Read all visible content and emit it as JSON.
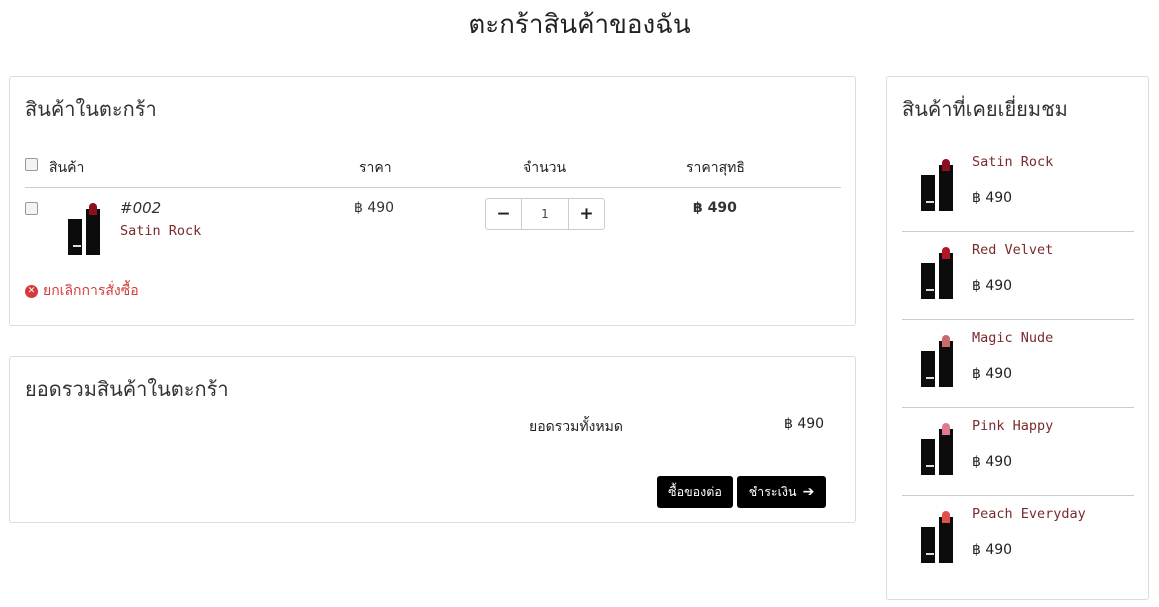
{
  "page": {
    "title": "ตะกร้าสินค้าของฉัน"
  },
  "cart": {
    "heading": "สินค้าในตะกร้า",
    "columns": {
      "product": "สินค้า",
      "price": "ราคา",
      "quantity": "จำนวน",
      "net_price": "ราคาสุทธิ"
    },
    "items": [
      {
        "code": "#002",
        "name": "Satin Rock",
        "price": "฿ 490",
        "quantity": "1",
        "net_price": "฿ 490",
        "shade": "#8a1020"
      }
    ],
    "decrement_label": "−",
    "increment_label": "+",
    "cancel_label": "ยกเลิกการสั่งซื้อ"
  },
  "summary": {
    "heading": "ยอดรวมสินค้าในตะกร้า",
    "total_label": "ยอดรวมทั้งหมด",
    "total_value": "฿ 490",
    "continue_label": "ซื้อของต่อ",
    "checkout_label": "ชำระเงิน"
  },
  "viewed": {
    "heading": "สินค้าที่เคยเยี่ยมชม",
    "items": [
      {
        "name": "Satin Rock",
        "price": "฿ 490",
        "shade": "#8a1020"
      },
      {
        "name": "Red Velvet",
        "price": "฿ 490",
        "shade": "#b0182a"
      },
      {
        "name": "Magic Nude",
        "price": "฿ 490",
        "shade": "#c96a6c"
      },
      {
        "name": "Pink Happy",
        "price": "฿ 490",
        "shade": "#e07a90"
      },
      {
        "name": "Peach Everyday",
        "price": "฿ 490",
        "shade": "#e0504a"
      }
    ]
  },
  "colors": {
    "link": "#7a2a2a",
    "danger": "#d43c3c",
    "button_bg": "#000000"
  },
  "icons": {
    "cancel": "close-circle-icon",
    "checkout": "arrow-right-icon"
  }
}
